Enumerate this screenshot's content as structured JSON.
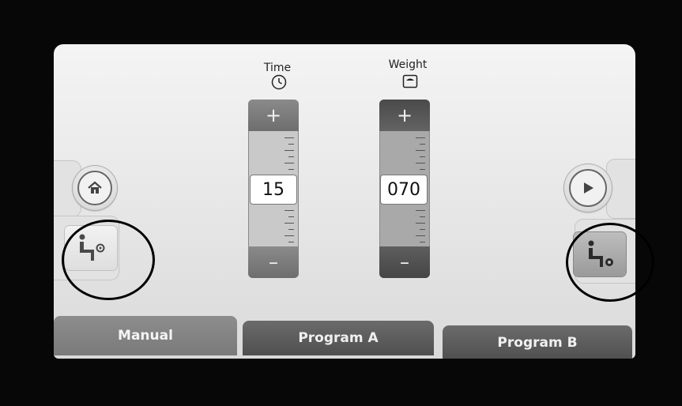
{
  "headers": {
    "time_label": "Time",
    "weight_label": "Weight"
  },
  "icons": {
    "time": "clock-icon",
    "weight": "scale-icon",
    "home": "home-icon",
    "play": "play-icon",
    "seat_left": "seated-person-icon",
    "seat_right": "seated-person-icon"
  },
  "time_stepper": {
    "plus_label": "+",
    "minus_label": "–",
    "value": "15"
  },
  "weight_stepper": {
    "plus_label": "+",
    "minus_label": "–",
    "value": "070"
  },
  "tabs": [
    {
      "label": "Manual",
      "active": true
    },
    {
      "label": "Program A",
      "active": false
    },
    {
      "label": "Program B",
      "active": false
    }
  ],
  "colors": {
    "background": "#070707",
    "screen": "#eeeeee",
    "tab_active": "#858585",
    "tab_inactive": "#5c5c5c",
    "weight_button": "#4e4e4e"
  }
}
